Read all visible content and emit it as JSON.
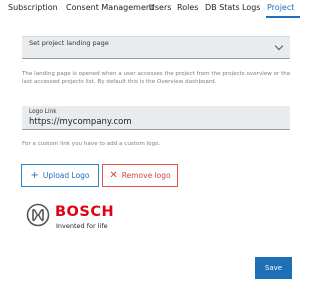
{
  "nav": {
    "tabs": [
      {
        "label": "Subscription"
      },
      {
        "label": "Consent Management"
      },
      {
        "label": "Users"
      },
      {
        "label": "Roles"
      },
      {
        "label": "DB Stats"
      },
      {
        "label": "Logs"
      },
      {
        "label": "Project"
      }
    ],
    "active_tab": "Project"
  },
  "landing_page": {
    "label": "Set project landing page",
    "help": "The landing page is opened when a user accesses the project from the projects overview or the last accessed projects list. By default this is the Overview dashboard."
  },
  "logo_link": {
    "label": "Logo Link",
    "value": "https://mycompany.com",
    "help": "For a custom link you have to add a custom logo."
  },
  "buttons": {
    "upload_logo": "Upload Logo",
    "remove_logo": "Remove logo",
    "save": "Save"
  },
  "logo": {
    "wordmark": "BOSCH",
    "tagline": "Invented for life"
  },
  "colors": {
    "accent": "#1e6fbf",
    "danger": "#d8463f",
    "brand_red": "#e20015",
    "save_bg": "#1f6fb6"
  },
  "icons": {
    "upload": "plus-icon",
    "remove": "x-icon",
    "select": "chevron-down-icon"
  }
}
